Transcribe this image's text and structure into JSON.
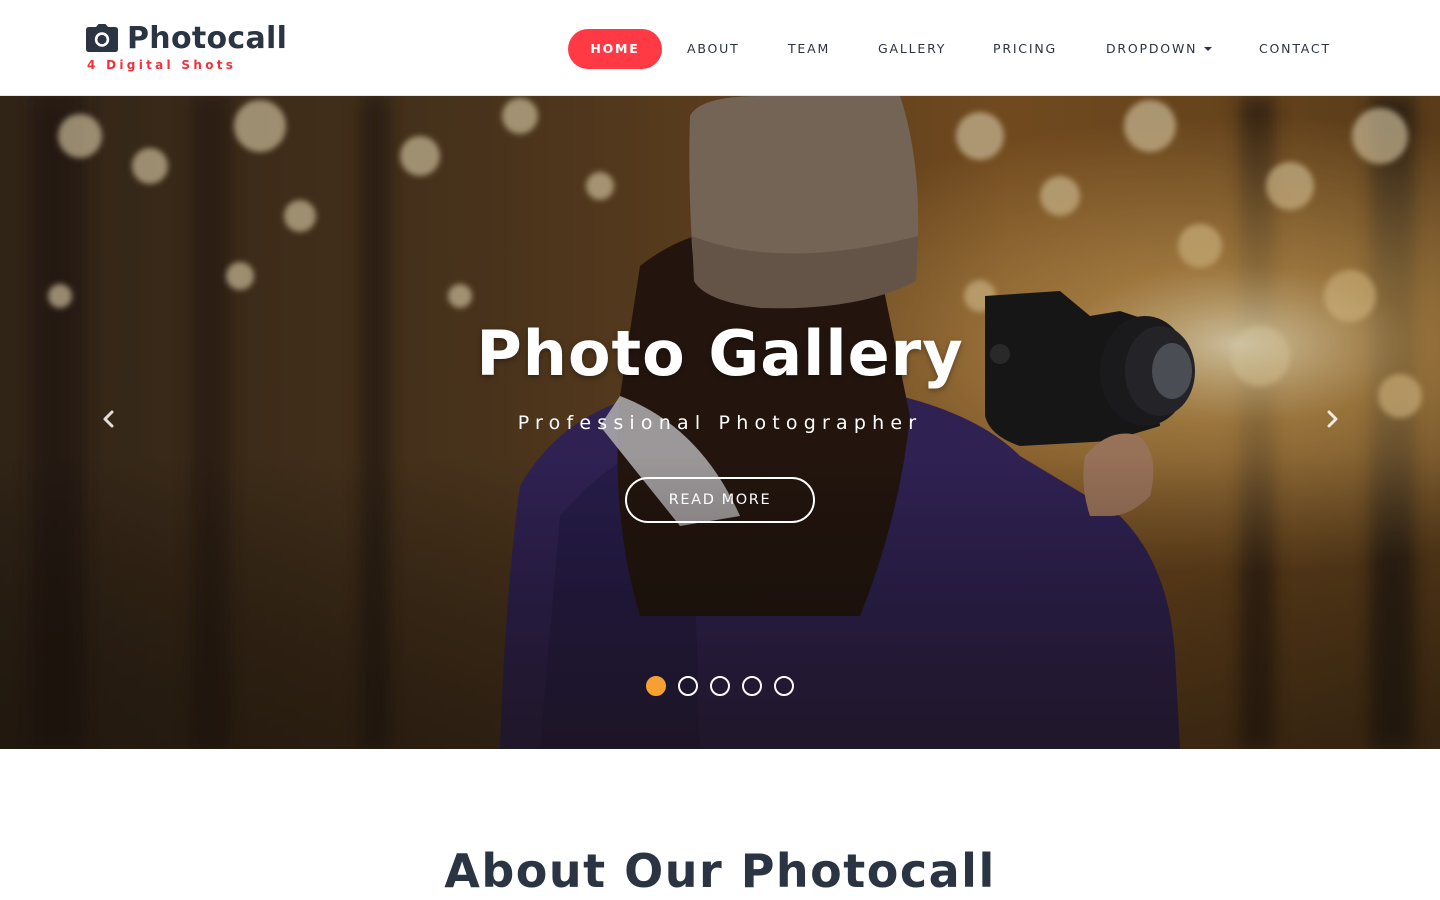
{
  "brand": {
    "name": "Photocall",
    "tagline": "4 Digital Shots",
    "icon": "camera-icon",
    "tagline_color": "#f2303a"
  },
  "nav": {
    "items": [
      {
        "label": "HOME",
        "active": true
      },
      {
        "label": "ABOUT"
      },
      {
        "label": "TEAM"
      },
      {
        "label": "GALLERY"
      },
      {
        "label": "PRICING"
      },
      {
        "label": "DROPDOWN",
        "has_caret": true
      },
      {
        "label": "CONTACT"
      }
    ],
    "active_color": "#ff3a45"
  },
  "hero": {
    "title": "Photo Gallery",
    "subtitle": "Professional Photographer",
    "button_label": "READ MORE",
    "prev_icon": "chevron-left-icon",
    "next_icon": "chevron-right-icon",
    "slides_total": 5,
    "active_slide": 1,
    "active_dot_color": "#f7a032"
  },
  "about": {
    "title": "About Our Photocall"
  }
}
